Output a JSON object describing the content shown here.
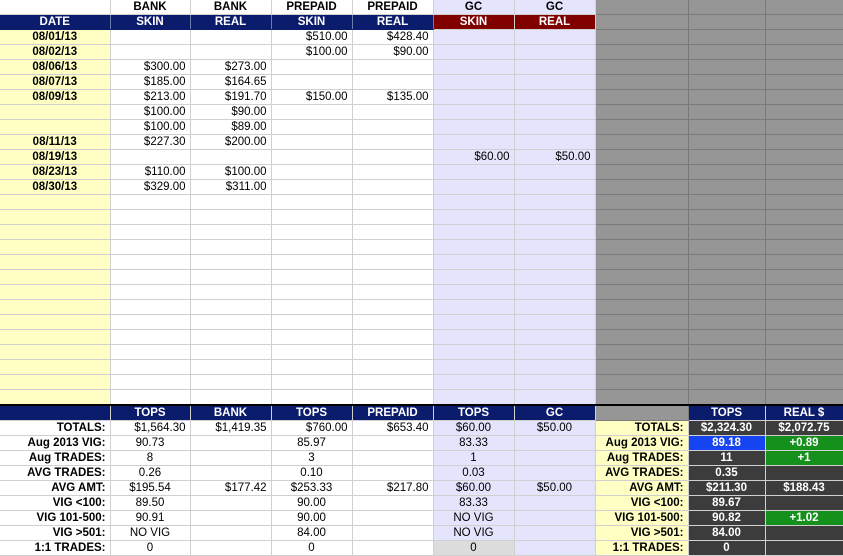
{
  "header": {
    "row1": [
      "",
      "BANK",
      "BANK",
      "PREPAID",
      "PREPAID",
      "GC",
      "GC"
    ],
    "row2": [
      "DATE",
      "SKIN",
      "REAL",
      "SKIN",
      "REAL",
      "SKIN",
      "REAL"
    ]
  },
  "rows": [
    [
      "08/01/13",
      "",
      "",
      "$510.00",
      "$428.40",
      "",
      ""
    ],
    [
      "08/02/13",
      "",
      "",
      "$100.00",
      "$90.00",
      "",
      ""
    ],
    [
      "08/06/13",
      "$300.00",
      "$273.00",
      "",
      "",
      "",
      ""
    ],
    [
      "08/07/13",
      "$185.00",
      "$164.65",
      "",
      "",
      "",
      ""
    ],
    [
      "08/09/13",
      "$213.00",
      "$191.70",
      "$150.00",
      "$135.00",
      "",
      ""
    ],
    [
      "",
      "$100.00",
      "$90.00",
      "",
      "",
      "",
      ""
    ],
    [
      "",
      "$100.00",
      "$89.00",
      "",
      "",
      "",
      ""
    ],
    [
      "08/11/13",
      "$227.30",
      "$200.00",
      "",
      "",
      "",
      ""
    ],
    [
      "08/19/13",
      "",
      "",
      "",
      "",
      "$60.00",
      "$50.00"
    ],
    [
      "08/23/13",
      "$110.00",
      "$100.00",
      "",
      "",
      "",
      ""
    ],
    [
      "08/30/13",
      "$329.00",
      "$311.00",
      "",
      "",
      "",
      ""
    ]
  ],
  "summary_header": [
    "",
    "TOPS",
    "BANK",
    "TOPS",
    "PREPAID",
    "TOPS",
    "GC"
  ],
  "summary": [
    [
      "TOTALS:",
      "$1,564.30",
      "$1,419.35",
      "$760.00",
      "$653.40",
      "$60.00",
      "$50.00"
    ],
    [
      "Aug 2013 VIG:",
      "90.73",
      "",
      "85.97",
      "",
      "83.33",
      ""
    ],
    [
      "Aug TRADES:",
      "8",
      "",
      "3",
      "",
      "1",
      ""
    ],
    [
      "AVG TRADES:",
      "0.26",
      "",
      "0.10",
      "",
      "0.03",
      ""
    ],
    [
      "AVG AMT:",
      "$195.54",
      "$177.42",
      "$253.33",
      "$217.80",
      "$60.00",
      "$50.00"
    ],
    [
      "VIG <100:",
      "89.50",
      "",
      "90.00",
      "",
      "83.33",
      ""
    ],
    [
      "VIG 101-500:",
      "90.91",
      "",
      "90.00",
      "",
      "NO VIG",
      ""
    ],
    [
      "VIG >501:",
      "NO VIG",
      "",
      "84.00",
      "",
      "NO VIG",
      ""
    ],
    [
      "1:1 TRADES:",
      "0",
      "",
      "0",
      "",
      "0",
      ""
    ]
  ],
  "right_header": [
    "",
    "TOPS",
    "REAL $"
  ],
  "right": [
    [
      "TOTALS:",
      "$2,324.30",
      "$2,072.75"
    ],
    [
      "Aug 2013 VIG:",
      "89.18",
      "+0.89"
    ],
    [
      "Aug TRADES:",
      "11",
      "+1"
    ],
    [
      "AVG TRADES:",
      "0.35",
      ""
    ],
    [
      "AVG AMT:",
      "$211.30",
      "$188.43"
    ],
    [
      "VIG <100:",
      "89.67",
      ""
    ],
    [
      "VIG 101-500:",
      "90.82",
      "+1.02"
    ],
    [
      "VIG >501:",
      "84.00",
      ""
    ],
    [
      "1:1 TRADES:",
      "0",
      ""
    ]
  ],
  "colors": {
    "navy": "#0c1c6c",
    "maroon": "#800000",
    "yellow": "#ffffc4",
    "lavender": "#e4e4fc",
    "gray": "#969696",
    "blue": "#1544f0",
    "green": "#15901c"
  }
}
